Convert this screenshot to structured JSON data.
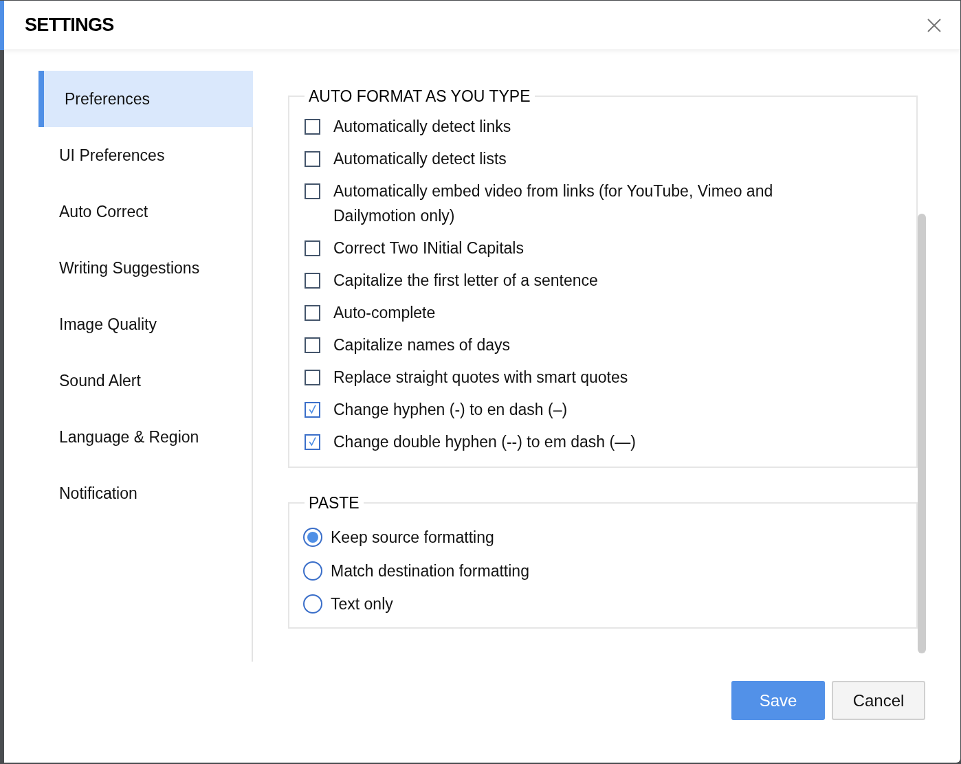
{
  "dialog": {
    "title": "SETTINGS"
  },
  "sidebar": {
    "items": [
      {
        "label": "Preferences",
        "selected": true
      },
      {
        "label": "UI Preferences",
        "selected": false
      },
      {
        "label": "Auto Correct",
        "selected": false
      },
      {
        "label": "Writing Suggestions",
        "selected": false
      },
      {
        "label": "Image Quality",
        "selected": false
      },
      {
        "label": "Sound Alert",
        "selected": false
      },
      {
        "label": "Language & Region",
        "selected": false
      },
      {
        "label": "Notification",
        "selected": false
      }
    ]
  },
  "auto_format": {
    "title": "AUTO FORMAT AS YOU TYPE",
    "options": [
      {
        "label": "Automatically detect links",
        "checked": false
      },
      {
        "label": "Automatically detect lists",
        "checked": false
      },
      {
        "label": "Automatically embed video from links (for YouTube, Vimeo and Dailymotion only)",
        "checked": false
      },
      {
        "label": "Correct Two INitial Capitals",
        "checked": false
      },
      {
        "label": "Capitalize the first letter of a sentence",
        "checked": false
      },
      {
        "label": "Auto-complete",
        "checked": false
      },
      {
        "label": "Capitalize names of days",
        "checked": false
      },
      {
        "label": "Replace straight quotes with smart quotes",
        "checked": false
      },
      {
        "label": "Change hyphen (-) to en dash (–)",
        "checked": true
      },
      {
        "label": "Change double hyphen (--) to em dash (—)",
        "checked": true
      }
    ]
  },
  "paste": {
    "title": "PASTE",
    "options": [
      {
        "label": "Keep source formatting",
        "selected": true
      },
      {
        "label": "Match destination formatting",
        "selected": false
      },
      {
        "label": "Text only",
        "selected": false
      }
    ]
  },
  "buttons": [
    {
      "label": "Save",
      "kind": "primary"
    },
    {
      "label": "Cancel",
      "kind": "secondary"
    }
  ]
}
